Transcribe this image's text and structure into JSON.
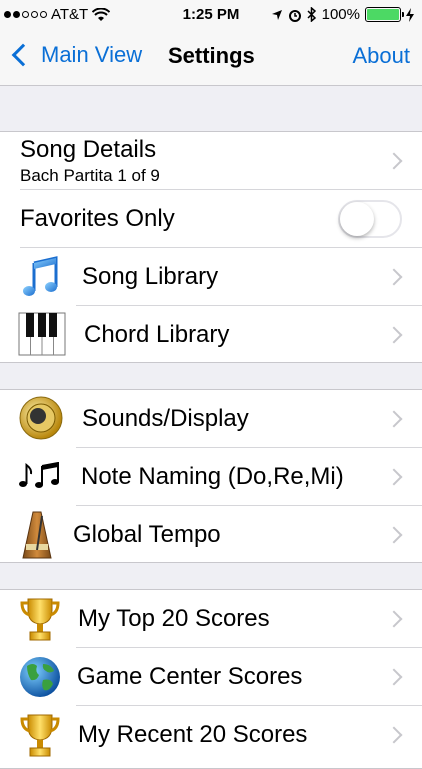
{
  "status_bar": {
    "carrier": "AT&T",
    "time": "1:25 PM",
    "battery": "100%",
    "signal_bars_filled": 2,
    "signal_bars_total": 5
  },
  "nav": {
    "back_label": "Main View",
    "title": "Settings",
    "about_label": "About"
  },
  "rows": {
    "song_details": {
      "label": "Song Details",
      "sub": "Bach Partita 1 of 9"
    },
    "favorites_only": {
      "label": "Favorites Only",
      "on": false
    },
    "song_library": {
      "label": "Song Library",
      "icon": "music-notes-icon"
    },
    "chord_library": {
      "label": "Chord Library",
      "icon": "piano-keys-icon"
    },
    "sounds_display": {
      "label": "Sounds/Display",
      "icon": "speaker-icon"
    },
    "note_naming": {
      "label": "Note Naming (Do,Re,Mi)",
      "icon": "eighth-notes-icon"
    },
    "global_tempo": {
      "label": "Global Tempo",
      "icon": "metronome-icon"
    },
    "top_scores": {
      "label": "My Top 20 Scores",
      "icon": "trophy-icon"
    },
    "game_center": {
      "label": "Game Center Scores",
      "icon": "globe-icon"
    },
    "recent_scores": {
      "label": "My Recent 20 Scores",
      "icon": "trophy-icon"
    }
  },
  "colors": {
    "accent": "#0a6fd6",
    "background": "#efeff4",
    "battery": "#4cd964"
  }
}
